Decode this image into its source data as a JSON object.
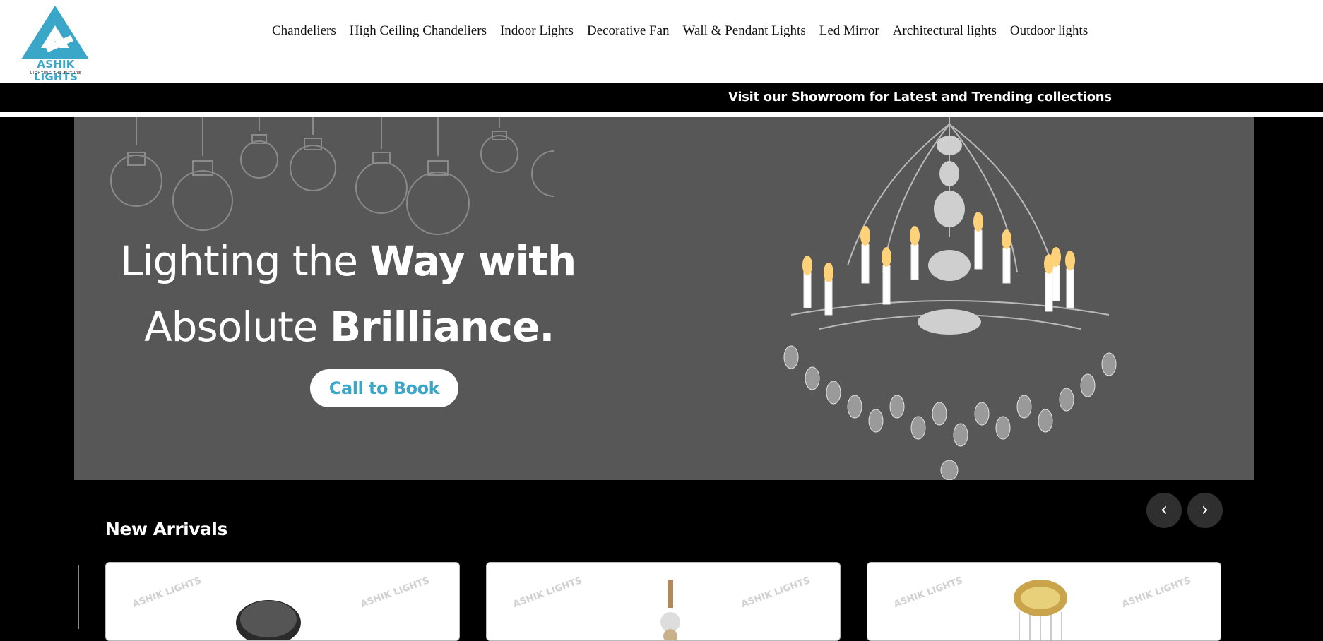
{
  "brand": {
    "name": "ASHIK LIGHTS",
    "tagline": "LIGHTING THE FUTURE",
    "accent_color": "#3aa6c8"
  },
  "nav": {
    "items": [
      {
        "label": "Chandeliers"
      },
      {
        "label": "High Ceiling Chandeliers"
      },
      {
        "label": "Indoor Lights"
      },
      {
        "label": "Decorative Fan"
      },
      {
        "label": "Wall & Pendant Lights"
      },
      {
        "label": "Led Mirror"
      },
      {
        "label": "Architectural lights"
      },
      {
        "label": "Outdoor lights"
      }
    ]
  },
  "announcement": {
    "text": "Visit our Showroom for Latest and Trending collections"
  },
  "hero": {
    "line1_light": "Lighting the ",
    "line1_bold": "Way with",
    "line2_light": "Absolute ",
    "line2_bold": "Brilliance.",
    "cta_label": "Call to Book",
    "background_color": "#575757"
  },
  "carousel": {
    "prev_icon": "chevron-left-icon",
    "next_icon": "chevron-right-icon",
    "prev_glyph": "‹",
    "next_glyph": "›"
  },
  "new_arrivals": {
    "title": "New Arrivals",
    "watermark": "ASHIK LIGHTS"
  }
}
